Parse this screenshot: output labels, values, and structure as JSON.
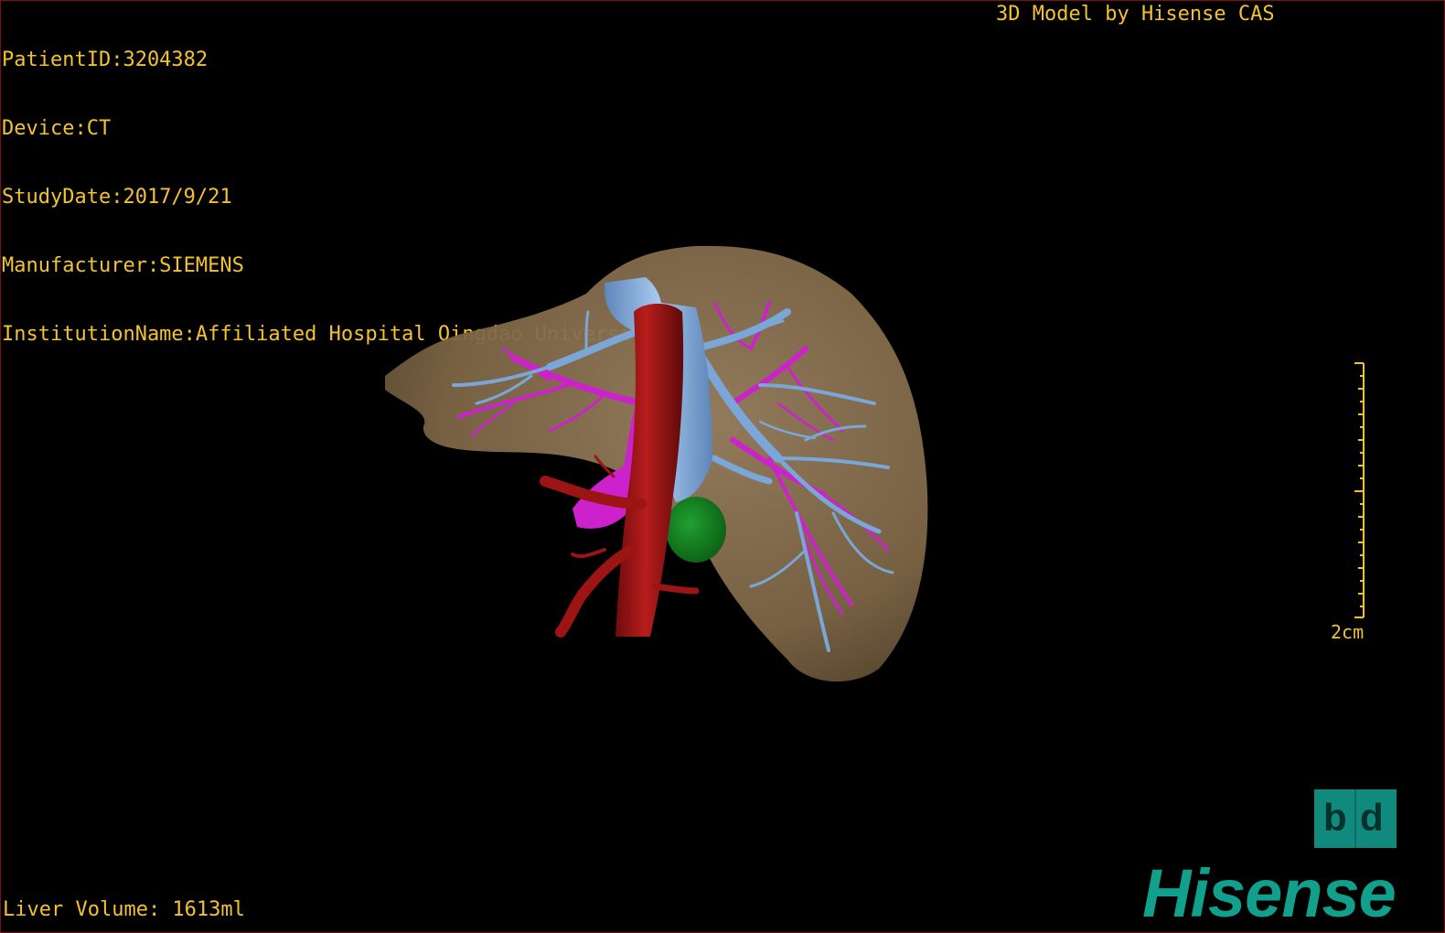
{
  "info": {
    "patient_id": "PatientID:3204382",
    "device": "Device:CT",
    "study_date": "StudyDate:2017/9/21",
    "manufacturer": "Manufacturer:SIEMENS",
    "institution": "InstitutionName:Affiliated Hospital Qingdao University-C"
  },
  "watermark": "3D Model by Hisense CAS",
  "footer": {
    "liver_volume": "Liver Volume: 1613ml"
  },
  "scale": {
    "label": "2cm"
  },
  "orientation": {
    "left": "d",
    "right": "d"
  },
  "brand": {
    "name": "Hisense"
  },
  "colors": {
    "text": "#f2c230",
    "liver": "#8a7150",
    "portal_vein": "#7aa6d8",
    "hepatic_vein": "#cc22cc",
    "vena_cava": "#9c1414",
    "tumor": "#0f7a1a",
    "brand": "#10a08c"
  }
}
